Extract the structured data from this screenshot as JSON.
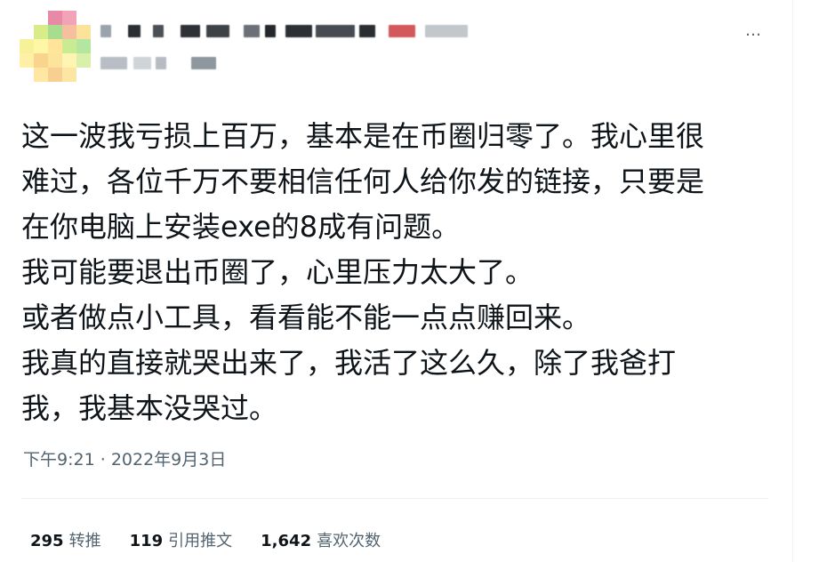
{
  "tweet": {
    "text": "这一波我亏损上百万，基本是在币圈归零了。我心里很\n难过，各位千万不要相信任何人给你发的链接，只要是\n在你电脑上安装exe的8成有问题。\n我可能要退出币圈了，心里压力太大了。\n或者做点小工具，看看能不能一点点赚回来。\n我真的直接就哭出来了，我活了这么久，除了我爸打\n我，我基本没哭过。",
    "time": "下午9:21",
    "separator": "·",
    "date": "2022年9月3日"
  },
  "more_icon": "…",
  "stats": [
    {
      "count": "295",
      "label": "转推"
    },
    {
      "count": "119",
      "label": "引用推文"
    },
    {
      "count": "1,642",
      "label": "喜欢次数"
    }
  ],
  "icons": {
    "more": "more-horizontal-icon"
  }
}
